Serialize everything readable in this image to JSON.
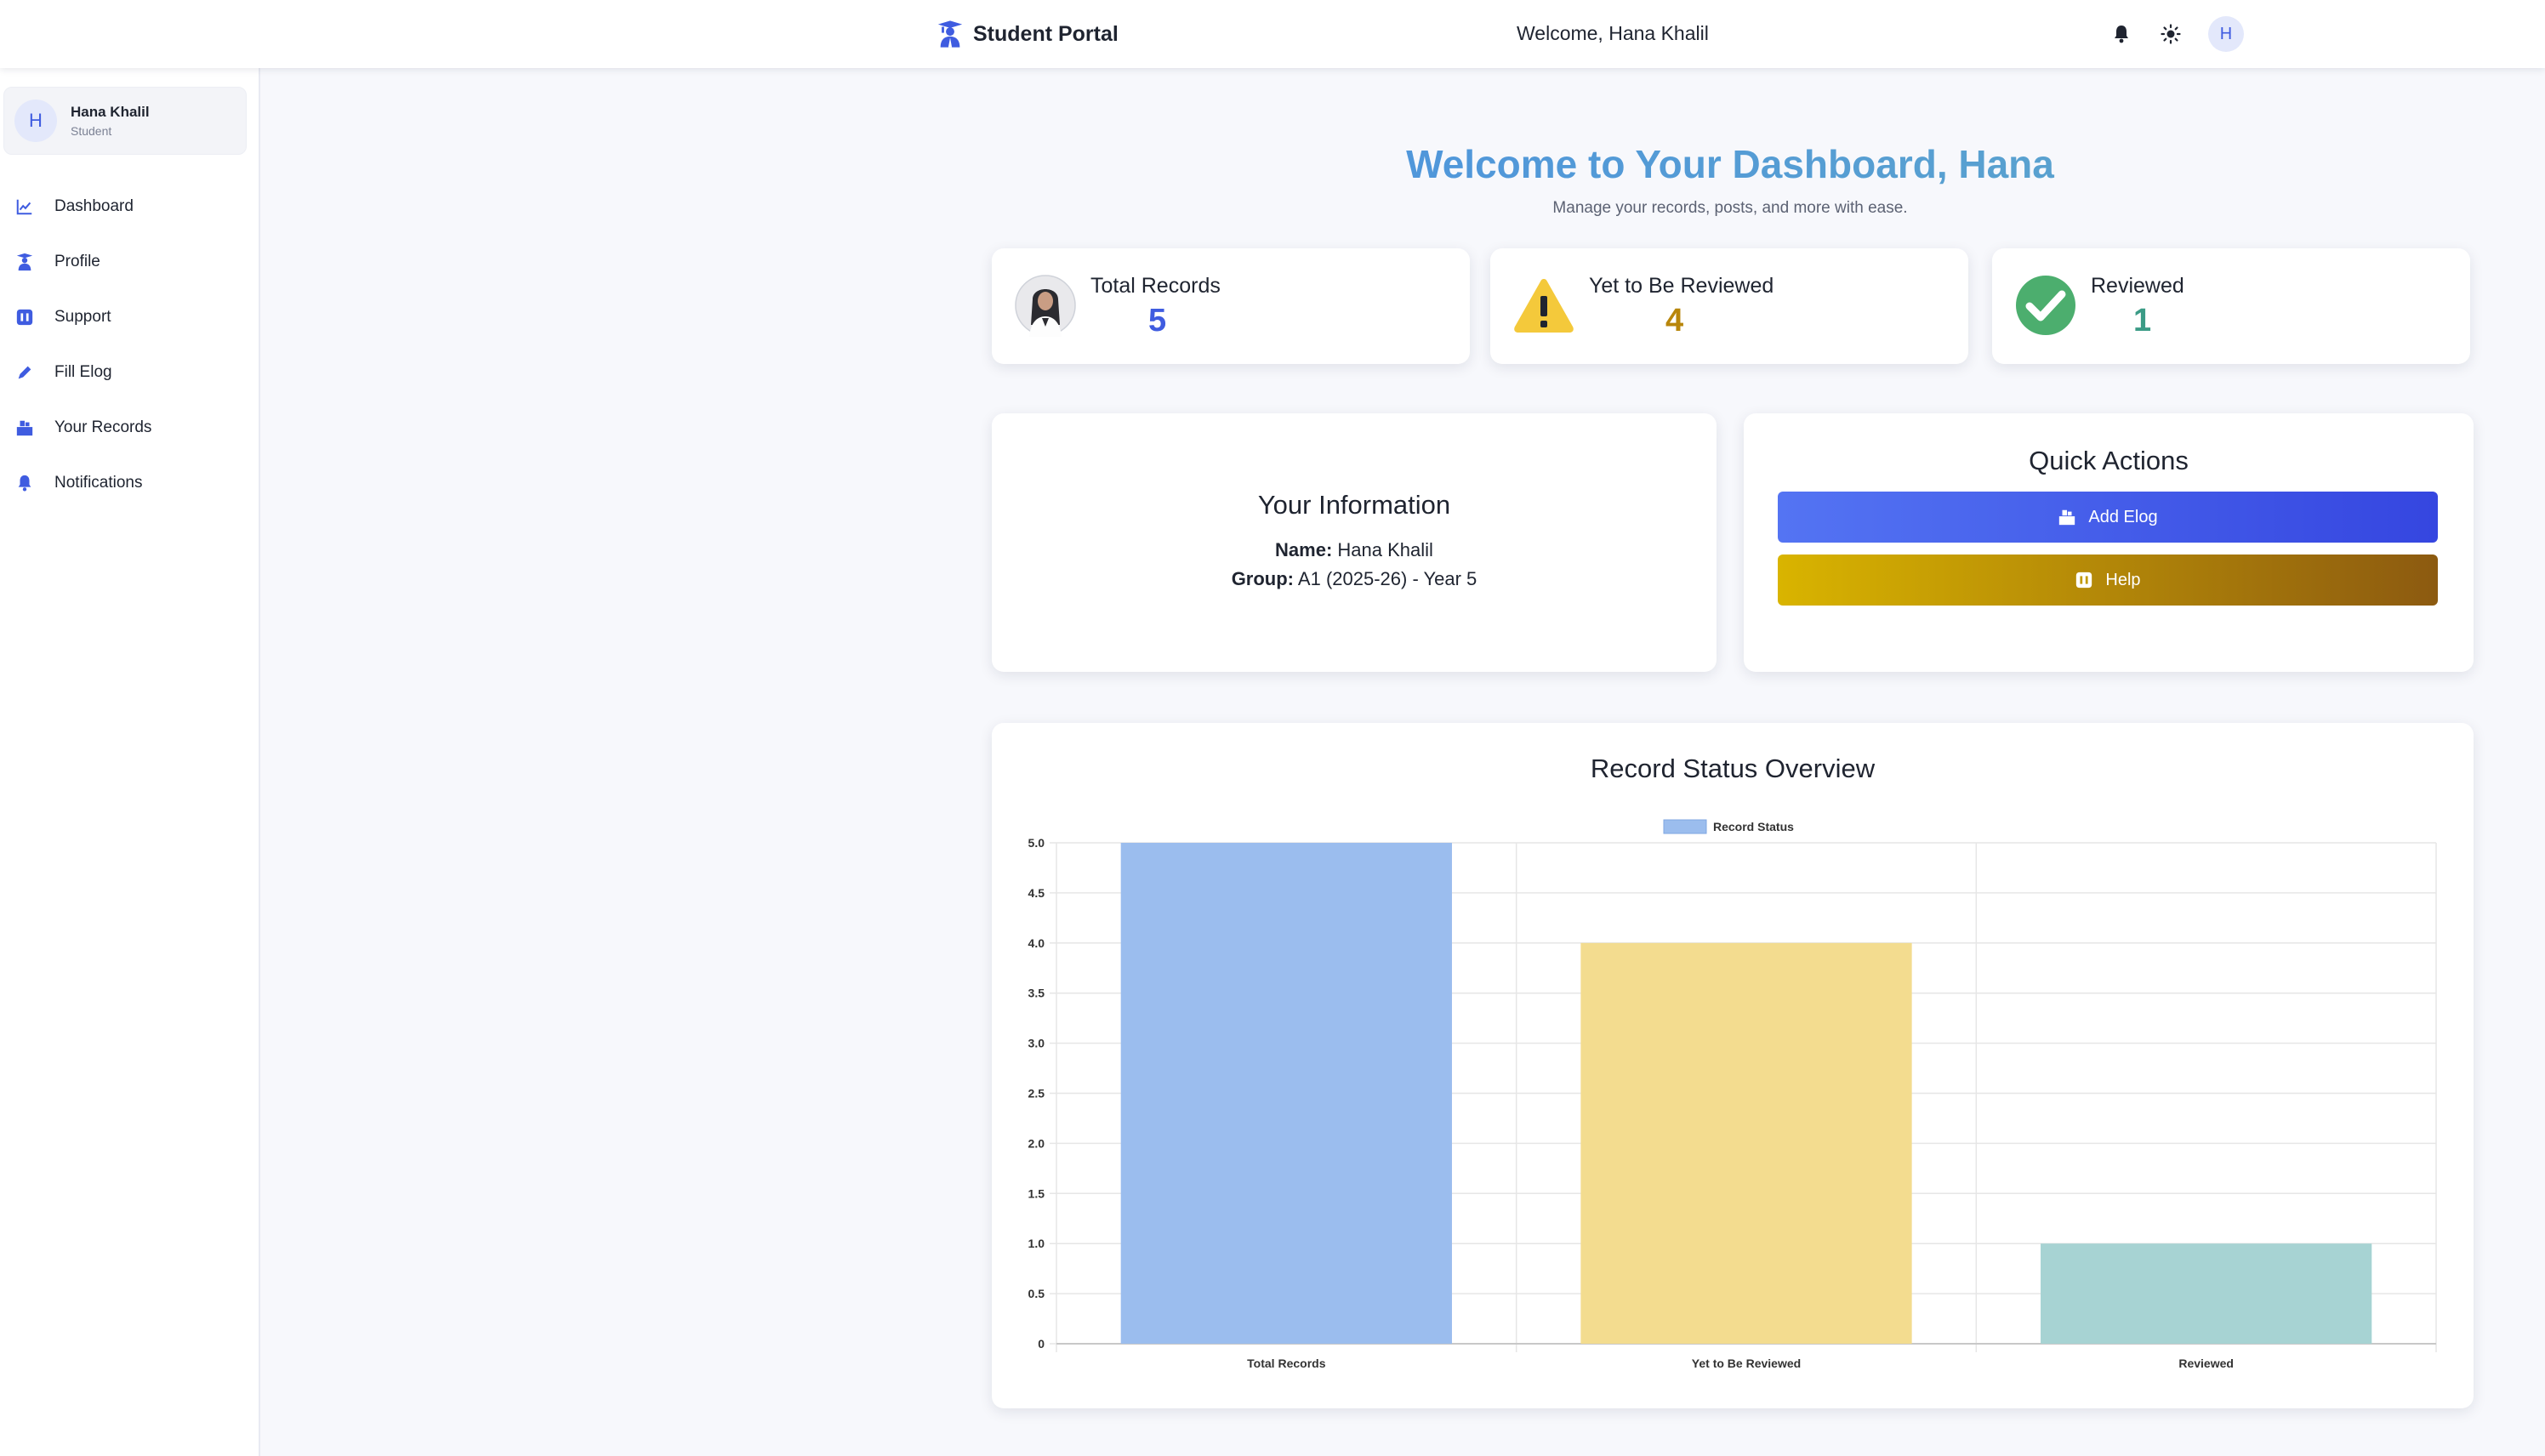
{
  "header": {
    "brand": "Student Portal",
    "welcome": "Welcome, Hana Khalil",
    "avatar_initial": "H",
    "icons": [
      "bell-icon",
      "sun-icon"
    ]
  },
  "sidebar": {
    "user": {
      "initial": "H",
      "name": "Hana Khalil",
      "role": "Student"
    },
    "items": [
      {
        "label": "Dashboard",
        "icon": "chart-line-icon"
      },
      {
        "label": "Profile",
        "icon": "graduate-icon"
      },
      {
        "label": "Support",
        "icon": "support-icon"
      },
      {
        "label": "Fill Elog",
        "icon": "pencil-icon"
      },
      {
        "label": "Your Records",
        "icon": "records-icon"
      },
      {
        "label": "Notifications",
        "icon": "bell-icon"
      }
    ]
  },
  "main": {
    "title": "Welcome to Your Dashboard, Hana",
    "subtitle": "Manage your records, posts, and more with ease.",
    "stats": [
      {
        "label": "Total Records",
        "value": "5",
        "icon": "student-photo"
      },
      {
        "label": "Yet to Be Reviewed",
        "value": "4",
        "icon": "warning-icon"
      },
      {
        "label": "Reviewed",
        "value": "1",
        "icon": "check-circle-icon"
      }
    ],
    "info": {
      "title": "Your Information",
      "name_label": "Name:",
      "name_value": "Hana Khalil",
      "group_label": "Group:",
      "group_value": "A1 (2025-26) - Year 5"
    },
    "quick_actions": {
      "title": "Quick Actions",
      "add_label": "Add Elog",
      "help_label": "Help"
    },
    "chart_title": "Record Status Overview"
  },
  "colors": {
    "accent": "#3f5ce0",
    "warning": "#b8860b",
    "success": "#3b9b86"
  },
  "chart_data": {
    "type": "bar",
    "title": "Record Status Overview",
    "categories": [
      "Total Records",
      "Yet to Be Reviewed",
      "Reviewed"
    ],
    "series": [
      {
        "name": "Record Status",
        "values": [
          5,
          4,
          1
        ]
      }
    ],
    "bar_colors": [
      "#9bbdee",
      "#f3dc8f",
      "#a7d3d3"
    ],
    "ylim": [
      0,
      5
    ],
    "yticks": [
      "0",
      "0.5",
      "1.0",
      "1.5",
      "2.0",
      "2.5",
      "3.0",
      "3.5",
      "4.0",
      "4.5",
      "5.0"
    ],
    "grid": true,
    "legend": "top"
  }
}
